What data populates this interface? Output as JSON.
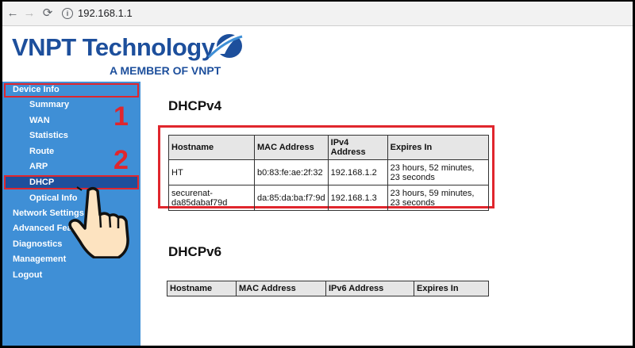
{
  "browser": {
    "url": "192.168.1.1"
  },
  "header": {
    "brand": "VNPT Technology",
    "tagline": "A MEMBER OF VNPT"
  },
  "sidebar": {
    "items": [
      {
        "label": "Device Info"
      },
      {
        "label": "Summary"
      },
      {
        "label": "WAN"
      },
      {
        "label": "Statistics"
      },
      {
        "label": "Route"
      },
      {
        "label": "ARP"
      },
      {
        "label": "DHCP"
      },
      {
        "label": "Optical Info"
      },
      {
        "label": "Network Settings"
      },
      {
        "label": "Advanced Features"
      },
      {
        "label": "Diagnostics"
      },
      {
        "label": "Management"
      },
      {
        "label": "Logout"
      }
    ]
  },
  "annotations": {
    "step1": "1",
    "step2": "2"
  },
  "dhcpv4": {
    "title": "DHCPv4",
    "headers": [
      "Hostname",
      "MAC Address",
      "IPv4 Address",
      "Expires In"
    ],
    "rows": [
      [
        "HT",
        "b0:83:fe:ae:2f:32",
        "192.168.1.2",
        "23 hours, 52 minutes, 23 seconds"
      ],
      [
        "securenat-da85dabaf79d",
        "da:85:da:ba:f7:9d",
        "192.168.1.3",
        "23 hours, 59 minutes, 23 seconds"
      ]
    ]
  },
  "dhcpv6": {
    "title": "DHCPv6",
    "headers": [
      "Hostname",
      "MAC Address",
      "IPv6 Address",
      "Expires In"
    ]
  },
  "colors": {
    "brand": "#1d4f9c",
    "sidebar": "#3f8fd6",
    "highlight": "#e0262d",
    "selected": "#1d4f9c"
  }
}
